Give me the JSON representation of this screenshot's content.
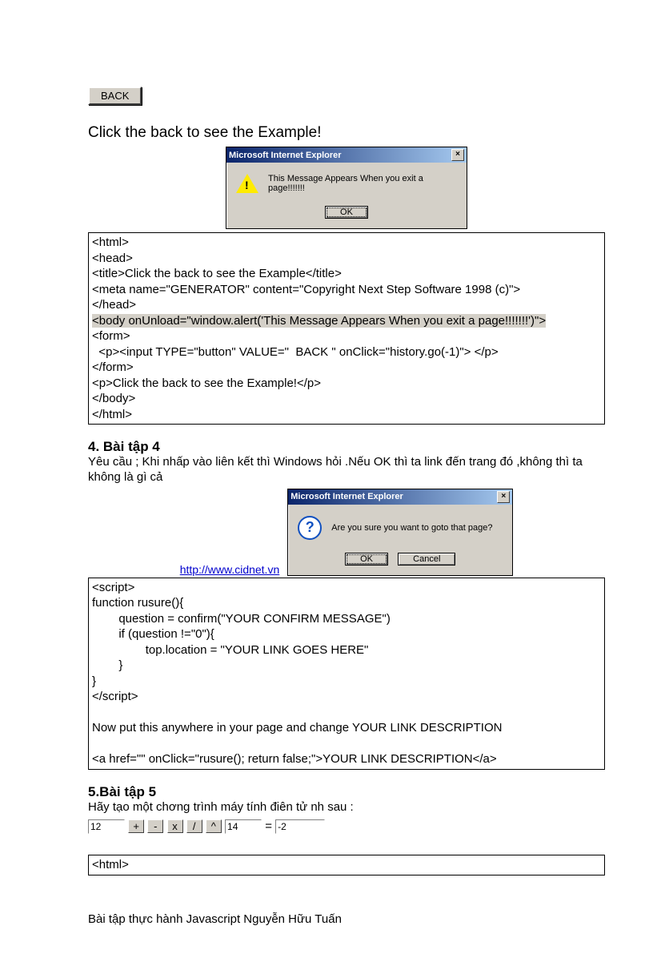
{
  "back_button": "BACK",
  "instruction": "Click the back to see the Example!",
  "dialog1": {
    "title": "Microsoft Internet Explorer",
    "message": "This Message Appears When you exit a page!!!!!!!",
    "ok": "OK"
  },
  "code1": "<html>\n<head>\n<title>Click the back to see the Example</title>\n<meta name=\"GENERATOR\" content=\"Copyright Next Step Software 1998 (c)\">\n</head>",
  "code1_hl": "<body onUnload=\"window.alert('This Message Appears When you exit a page!!!!!!!')\">",
  "code1b": "<form>\n  <p><input TYPE=\"button\" VALUE=\"  BACK \" onClick=\"history.go(-1)\"> </p>\n</form>\n<p>Click the back to see the Example!</p>\n</body>\n</html>",
  "ex4_title": "4. Bài tập 4",
  "ex4_desc": "Yêu cầu ; Khi nhấp vào liên kết thì Windows hỏi .Nếu OK thì ta link đến trang đó ,không thì ta không là gì cả",
  "dialog2": {
    "title": "Microsoft Internet Explorer",
    "message": "Are you sure you want to goto that page?",
    "ok": "OK",
    "cancel": "Cancel"
  },
  "link": "http://www.cidnet.vn",
  "code2": "<script>\nfunction rusure(){\n        question = confirm(\"YOUR CONFIRM MESSAGE\")\n        if (question !=\"0\"){\n                top.location = \"YOUR LINK GOES HERE\"\n        }\n}\n</scr",
  "code2b": "ipt>\n\nNow put this anywhere in your page and change YOUR LINK DESCRIPTION\n\n<a href=\"\" onClick=\"rusure(); return false;\">YOUR LINK DESCRIPTION</a>",
  "ex5_title": "5.Bài tập 5",
  "ex5_desc": "Hãy tạo một chơng    trình máy tính điên tử nh   sau :",
  "calc": {
    "a": "12",
    "ops": [
      "+",
      "-",
      "x",
      "/",
      "^"
    ],
    "b": "14",
    "eq": "=",
    "res": "-2"
  },
  "code3": "<html>",
  "footer": "Bài tập thực hành Javascript   Nguyễn Hữu Tuấn"
}
